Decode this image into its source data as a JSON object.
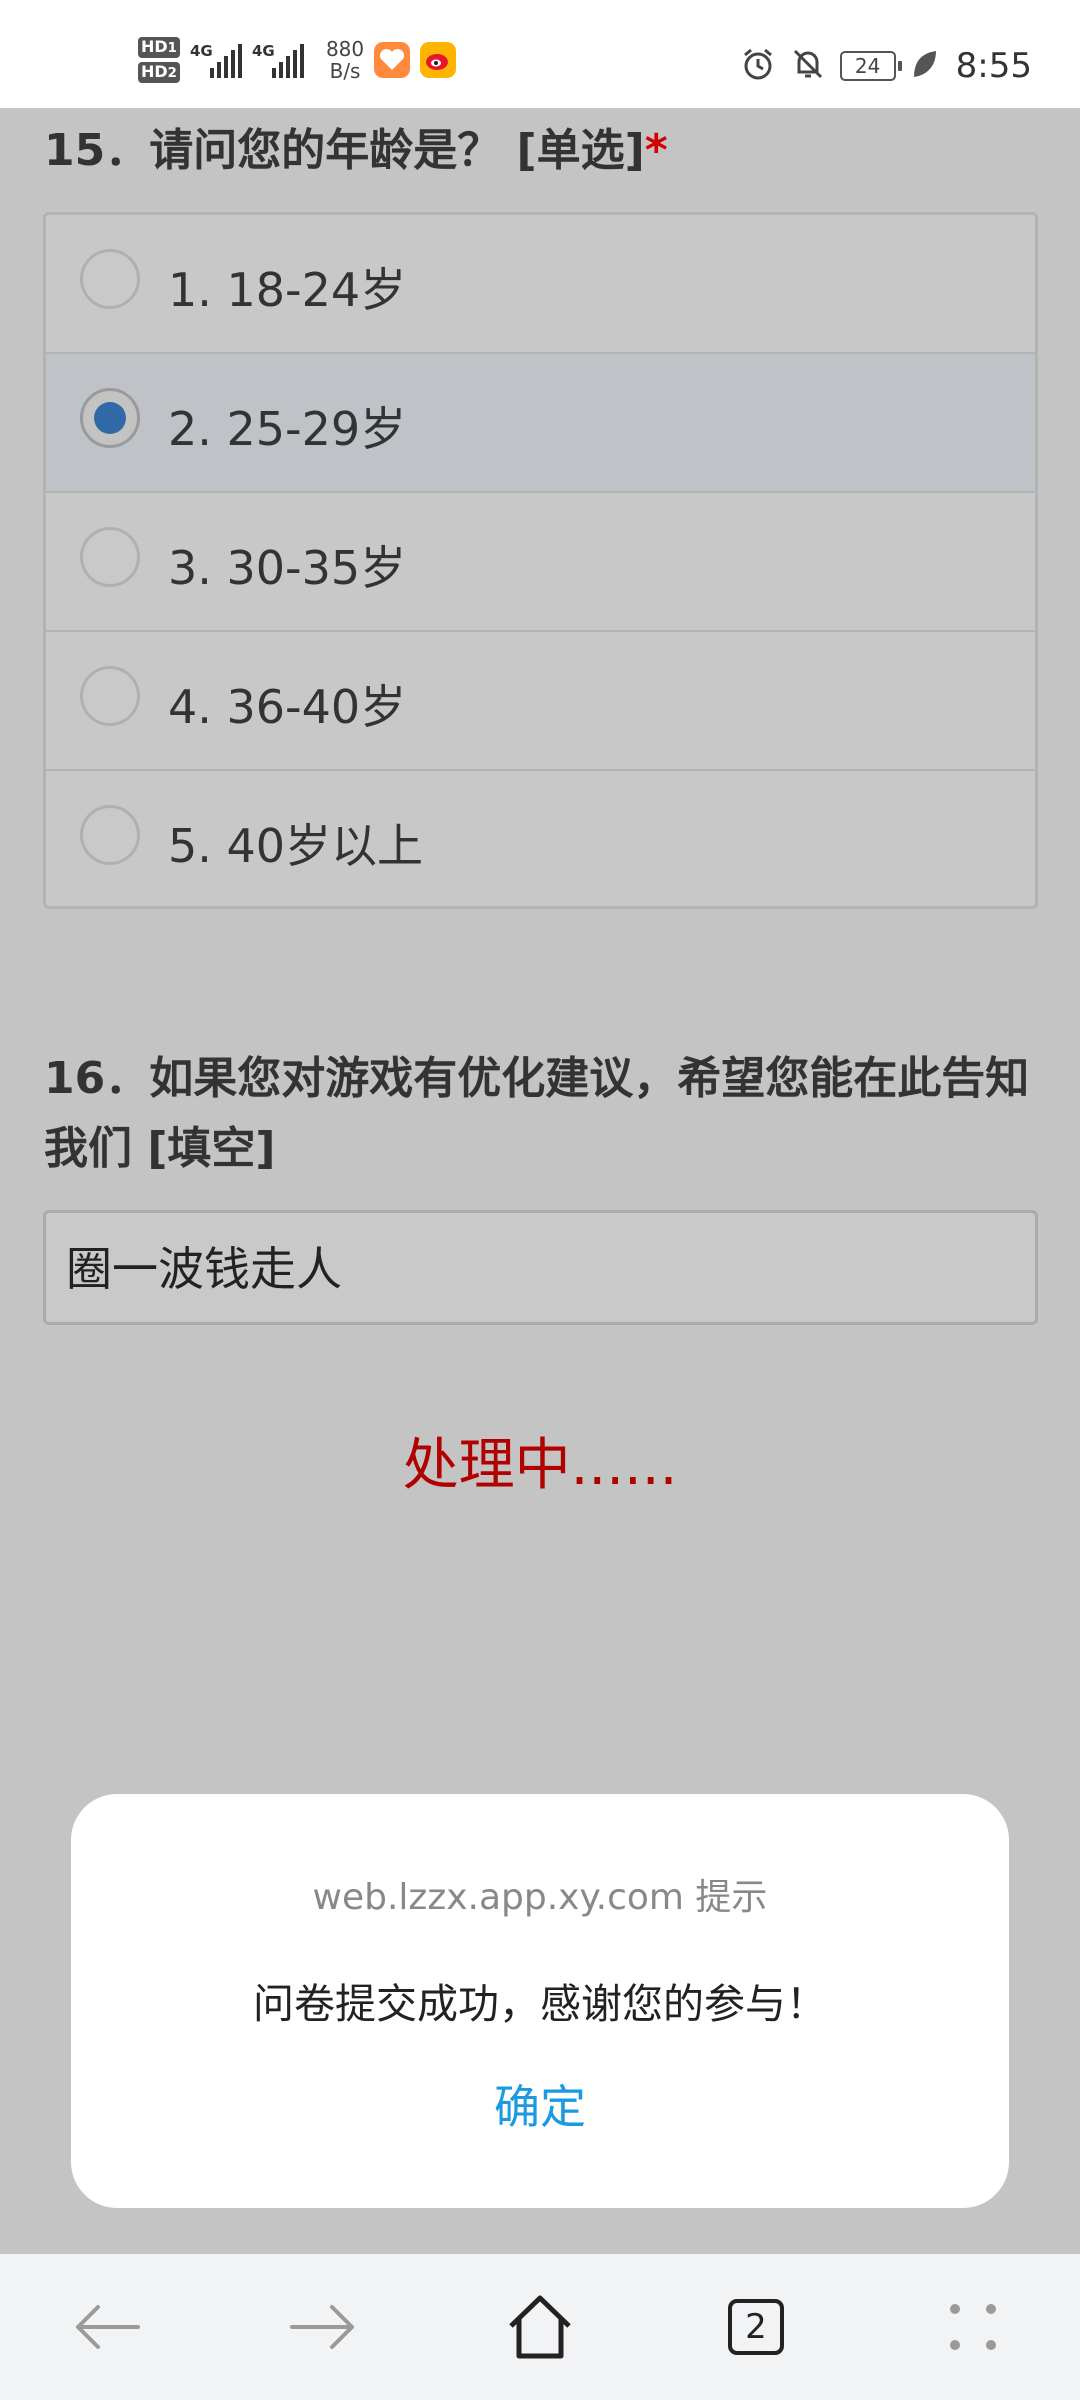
{
  "status_bar": {
    "hd1": "HD",
    "hd1_sub": "1",
    "hd2": "HD",
    "hd2_sub": "2",
    "net1": "4G",
    "net2": "4G",
    "speed_value": "880",
    "speed_unit": "B/s",
    "battery": "24",
    "time": "8:55"
  },
  "q15": {
    "title": "15．请问您的年龄是？ [单选]",
    "required_mark": "*",
    "options": [
      {
        "label": "1. 18-24岁",
        "selected": false
      },
      {
        "label": "2. 25-29岁",
        "selected": true
      },
      {
        "label": "3. 30-35岁",
        "selected": false
      },
      {
        "label": "4. 36-40岁",
        "selected": false
      },
      {
        "label": "5. 40岁以上",
        "selected": false
      }
    ]
  },
  "q16": {
    "title": "16．如果您对游戏有优化建议，希望您能在此告知我们 [填空]",
    "answer": "圈一波钱走人"
  },
  "processing": "处理中......",
  "dialog": {
    "origin": "web.lzzx.app.xy.com 提示",
    "message": "问卷提交成功，感谢您的参与！",
    "ok": "确定"
  },
  "navbar": {
    "tab_count": "2"
  },
  "colors": {
    "accent": "#1a9ae0",
    "processing": "#b00000",
    "radio_selected": "#2f6aa6"
  }
}
